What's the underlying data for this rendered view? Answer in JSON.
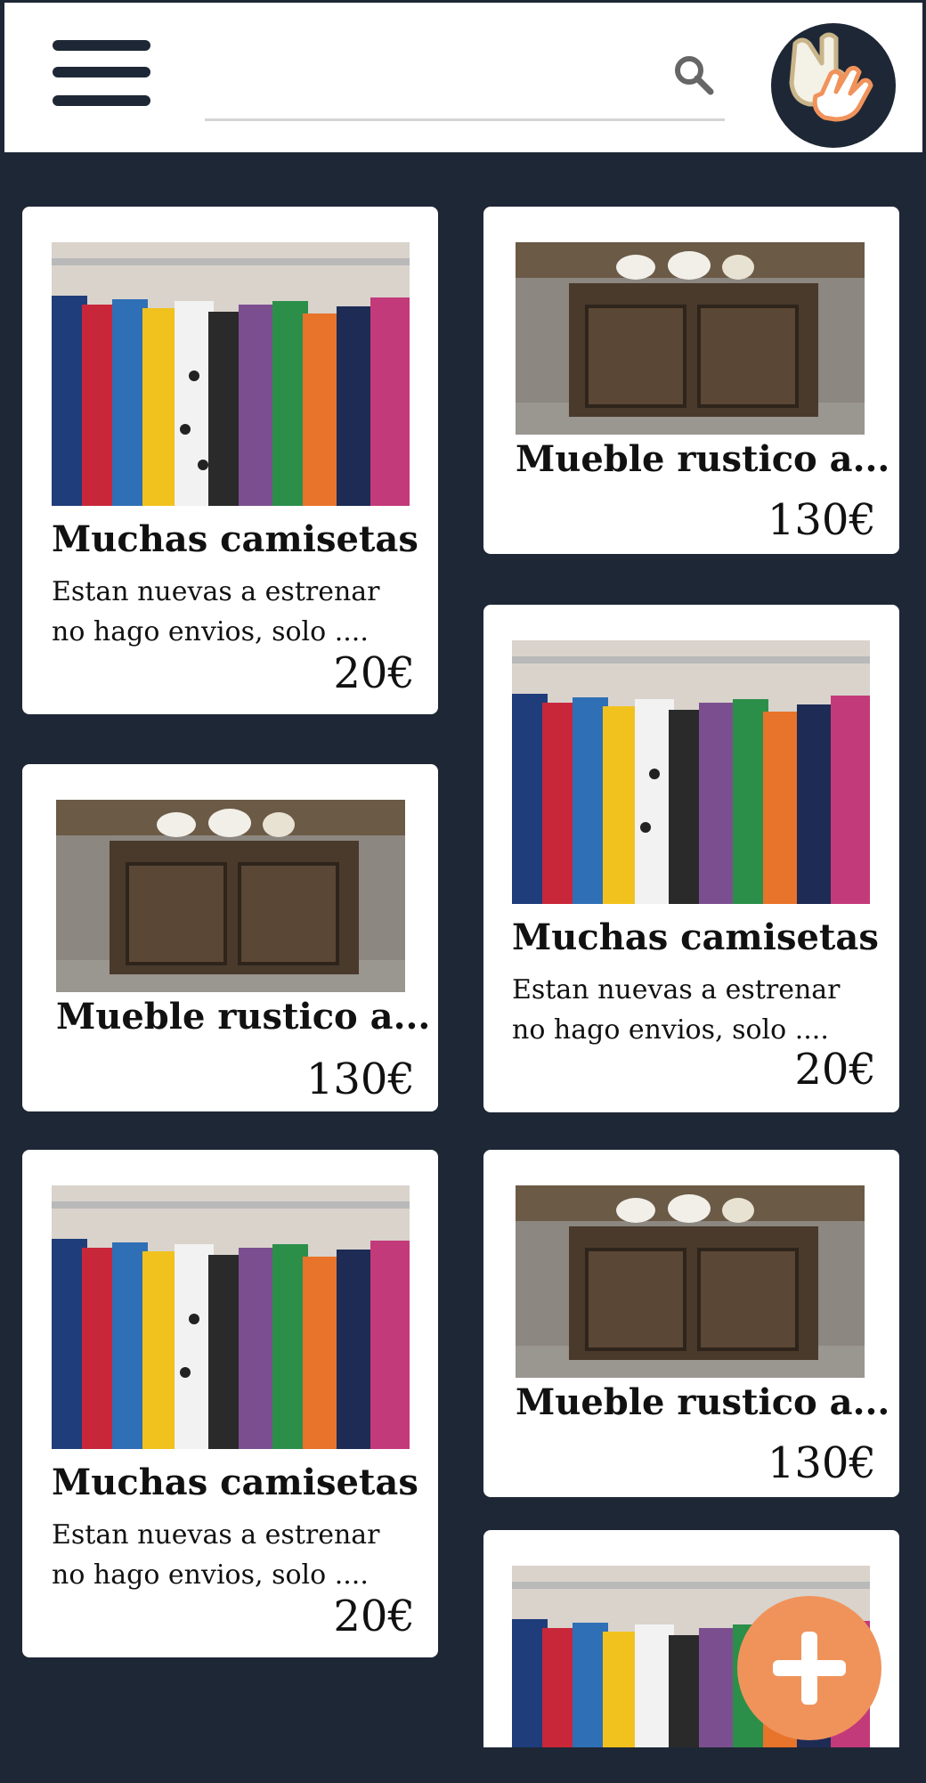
{
  "header": {
    "search": {
      "placeholder": "",
      "value": ""
    }
  },
  "listings": [
    {
      "type": "clothes",
      "title": "Muchas camisetas",
      "desc_line1": "Estan nuevas a estrenar",
      "desc_line2": "no hago envios, solo ....",
      "price": "20€"
    },
    {
      "type": "furniture",
      "title": "Mueble rustico a...",
      "price": "130€"
    },
    {
      "type": "furniture",
      "title": "Mueble rustico a...",
      "price": "130€"
    },
    {
      "type": "clothes",
      "title": "Muchas camisetas",
      "desc_line1": "Estan nuevas a estrenar",
      "desc_line2": "no hago envios, solo ....",
      "price": "20€"
    },
    {
      "type": "clothes",
      "title": "Muchas camisetas",
      "desc_line1": "Estan nuevas a estrenar",
      "desc_line2": "no hago envios, solo ....",
      "price": "20€"
    },
    {
      "type": "furniture",
      "title": "Mueble rustico a...",
      "price": "130€"
    },
    {
      "type": "clothes",
      "title": "",
      "price": ""
    }
  ],
  "colors": {
    "background": "#1e2735",
    "accent": "#f0935b",
    "card": "#ffffff"
  },
  "icons": [
    "menu-icon",
    "search-icon",
    "hands-logo-icon",
    "plus-icon"
  ]
}
